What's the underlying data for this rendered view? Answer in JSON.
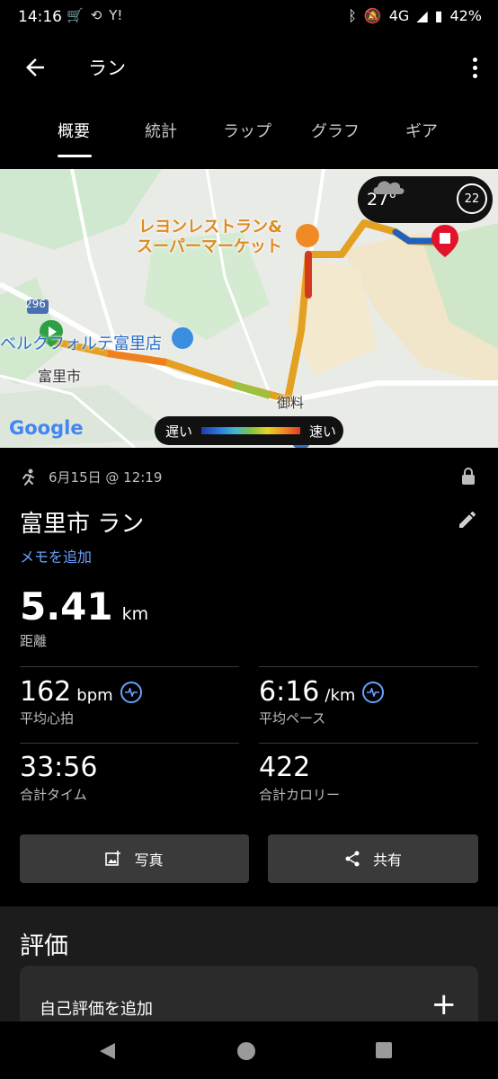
{
  "status_bar": {
    "time": "14:16",
    "network": "4G",
    "battery": "42%"
  },
  "app_bar": {
    "title": "ラン"
  },
  "tabs": [
    {
      "label": "概要"
    },
    {
      "label": "統計"
    },
    {
      "label": "ラップ"
    },
    {
      "label": "グラフ"
    },
    {
      "label": "ギア"
    }
  ],
  "map": {
    "weather_temp": "27°",
    "moon_value": "22",
    "poi_restaurant": "レヨンレストラン&\nスーパーマーケット",
    "poi_store": "ベルクフォルテ富里店",
    "place_city": "富里市",
    "place_gyoryo": "御料",
    "road_number": "296",
    "provider": "Google",
    "legend_slow": "遅い",
    "legend_fast": "速い"
  },
  "activity": {
    "date": "6月15日 @ 12:19",
    "title": "富里市 ラン",
    "memo_link": "メモを追加",
    "distance_value": "5.41",
    "distance_unit": "km",
    "distance_label": "距離",
    "hr_value": "162",
    "hr_unit": "bpm",
    "hr_label": "平均心拍",
    "pace_value": "6:16",
    "pace_unit": "/km",
    "pace_label": "平均ペース",
    "time_value": "33:56",
    "time_label": "合計タイム",
    "cal_value": "422",
    "cal_label": "合計カロリー"
  },
  "buttons": {
    "photo": "写真",
    "share": "共有"
  },
  "rating": {
    "heading": "評価",
    "add_self": "自己評価を追加"
  },
  "colors": {
    "accent": "#6aa0ff",
    "route_slow": "#1b3fa8",
    "route_fast": "#e23b20",
    "pin_end": "#e2132b",
    "pin_start": "#2ea043"
  }
}
